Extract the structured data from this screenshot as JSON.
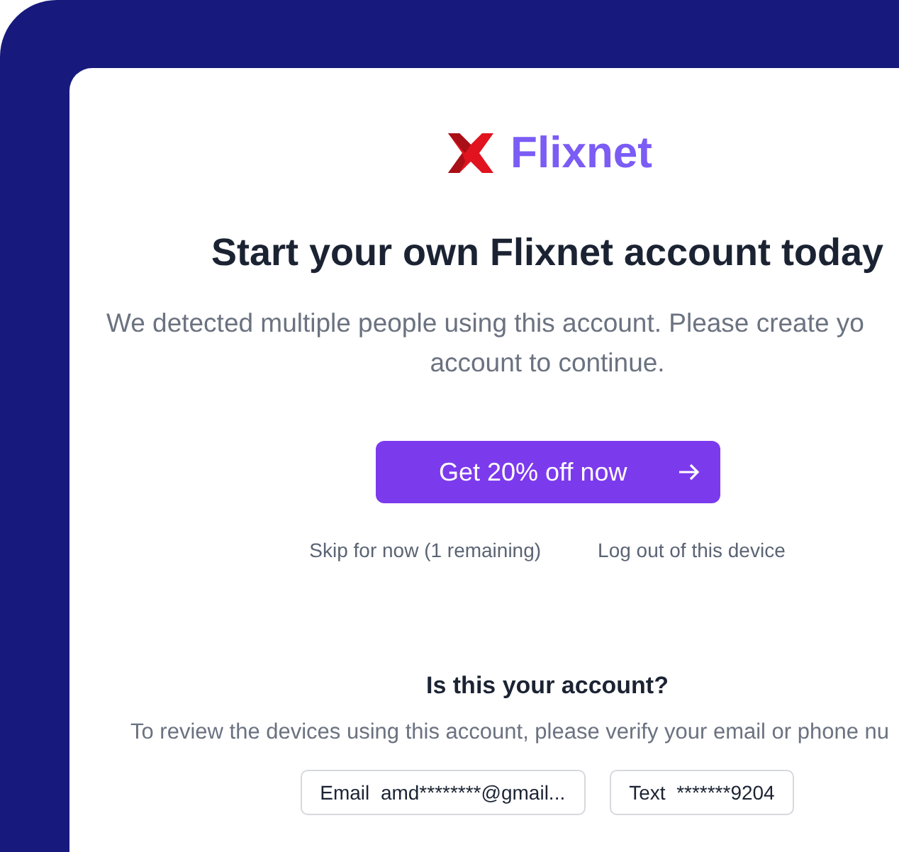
{
  "brand": {
    "name": "Flixnet"
  },
  "title": "Start your own Flixnet account today",
  "message_lines": [
    "We detected multiple people using this account. Please create yo",
    "account to continue."
  ],
  "primary_button": {
    "label": "Get 20% off now"
  },
  "links": [
    "Skip for now (1 remaining)",
    "Log out of this device"
  ],
  "verify": {
    "heading": "Is this your account?",
    "instruction": "To review the devices using this account, please verify your email or phone nu",
    "options": [
      {
        "label": "Email",
        "value": "amd********@gmail..."
      },
      {
        "label": "Text",
        "value": "*******9204"
      }
    ]
  }
}
